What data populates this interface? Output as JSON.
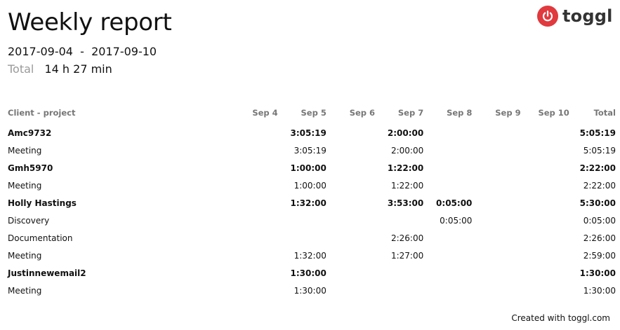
{
  "header": {
    "title": "Weekly report",
    "date_start": "2017-09-04",
    "date_separator": "-",
    "date_end": "2017-09-10",
    "total_label": "Total",
    "total_value": "14 h 27 min"
  },
  "logo": {
    "text": "toggl",
    "icon": "power-icon",
    "color": "#e0393e"
  },
  "table": {
    "columns": [
      "Client - project",
      "Sep 4",
      "Sep 5",
      "Sep 6",
      "Sep 7",
      "Sep 8",
      "Sep 9",
      "Sep 10",
      "Total"
    ],
    "rows": [
      {
        "type": "client",
        "cells": [
          "Amc9732",
          "",
          "3:05:19",
          "",
          "2:00:00",
          "",
          "",
          "",
          "5:05:19"
        ]
      },
      {
        "type": "project",
        "cells": [
          "Meeting",
          "",
          "3:05:19",
          "",
          "2:00:00",
          "",
          "",
          "",
          "5:05:19"
        ]
      },
      {
        "type": "client",
        "cells": [
          "Gmh5970",
          "",
          "1:00:00",
          "",
          "1:22:00",
          "",
          "",
          "",
          "2:22:00"
        ]
      },
      {
        "type": "project",
        "cells": [
          "Meeting",
          "",
          "1:00:00",
          "",
          "1:22:00",
          "",
          "",
          "",
          "2:22:00"
        ]
      },
      {
        "type": "client",
        "cells": [
          "Holly Hastings",
          "",
          "1:32:00",
          "",
          "3:53:00",
          "0:05:00",
          "",
          "",
          "5:30:00"
        ]
      },
      {
        "type": "project",
        "cells": [
          "Discovery",
          "",
          "",
          "",
          "",
          "0:05:00",
          "",
          "",
          "0:05:00"
        ]
      },
      {
        "type": "project",
        "cells": [
          "Documentation",
          "",
          "",
          "",
          "2:26:00",
          "",
          "",
          "",
          "2:26:00"
        ]
      },
      {
        "type": "project",
        "cells": [
          "Meeting",
          "",
          "1:32:00",
          "",
          "1:27:00",
          "",
          "",
          "",
          "2:59:00"
        ]
      },
      {
        "type": "client",
        "cells": [
          "Justinnewemail2",
          "",
          "1:30:00",
          "",
          "",
          "",
          "",
          "",
          "1:30:00"
        ]
      },
      {
        "type": "project",
        "cells": [
          "Meeting",
          "",
          "1:30:00",
          "",
          "",
          "",
          "",
          "",
          "1:30:00"
        ]
      }
    ]
  },
  "footer": {
    "text": "Created with toggl.com"
  }
}
